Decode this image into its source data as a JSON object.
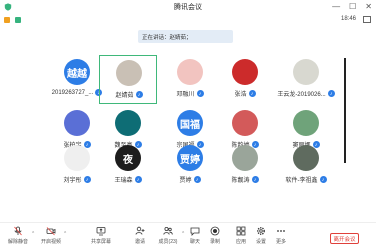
{
  "window": {
    "title": "腾讯会议"
  },
  "status": {
    "time": "18:46"
  },
  "speaking": {
    "text": "正在讲话：赵婧茹；"
  },
  "participants": [
    {
      "name": "越越",
      "avatar_text": "越越",
      "avatar_color": "#2d7de6",
      "label": "2019263727_..."
    },
    {
      "name": "赵婧茹",
      "avatar_text": "",
      "avatar_color": "#c9c0b5",
      "label": "赵婧茹",
      "active": true
    },
    {
      "name": "邓融川",
      "avatar_text": "",
      "avatar_color": "#f2c4c0",
      "label": "邓融川"
    },
    {
      "name": "张浩",
      "avatar_text": "",
      "avatar_color": "#cc2b2b",
      "label": "张浩"
    },
    {
      "name": "王云龙",
      "avatar_text": "",
      "avatar_color": "#d8d8d0",
      "label": "王云龙-2019026..."
    },
    {
      "name": "张柏宇",
      "avatar_text": "",
      "avatar_color": "#5a6fd6",
      "label": "张柏宇"
    },
    {
      "name": "魏至亮",
      "avatar_text": "",
      "avatar_color": "#0e6d75",
      "label": "魏至亮"
    },
    {
      "name": "宗国福",
      "avatar_text": "国福",
      "avatar_color": "#2d7de6",
      "label": "宗国福"
    },
    {
      "name": "陈韵婷",
      "avatar_text": "",
      "avatar_color": "#d35a5a",
      "label": "陈韵婷"
    },
    {
      "name": "窦丽娜",
      "avatar_text": "",
      "avatar_color": "#6fa37a",
      "label": "窦丽娜"
    },
    {
      "name": "刘宇彤",
      "avatar_text": "",
      "avatar_color": "#efefef",
      "label": "刘宇彤"
    },
    {
      "name": "王瑞森",
      "avatar_text": "夜",
      "avatar_color": "#1d1d1d",
      "label": "王瑞森"
    },
    {
      "name": "贾婷",
      "avatar_text": "贾婷",
      "avatar_color": "#2d7de6",
      "label": "贾婷"
    },
    {
      "name": "陈靓涛",
      "avatar_text": "",
      "avatar_color": "#9aa59a",
      "label": "陈靓涛"
    },
    {
      "name": "软件-李祖鑫",
      "avatar_text": "",
      "avatar_color": "#5f6b5f",
      "label": "软件-李祖鑫"
    }
  ],
  "toolbar": {
    "mute": "解除静音",
    "video": "开启视频",
    "share": "共享屏幕",
    "invite": "邀请",
    "members": "成员(23)",
    "chat": "聊天",
    "record": "录制",
    "apps": "应用",
    "settings": "设置",
    "more": "更多",
    "leave": "离开会议"
  }
}
